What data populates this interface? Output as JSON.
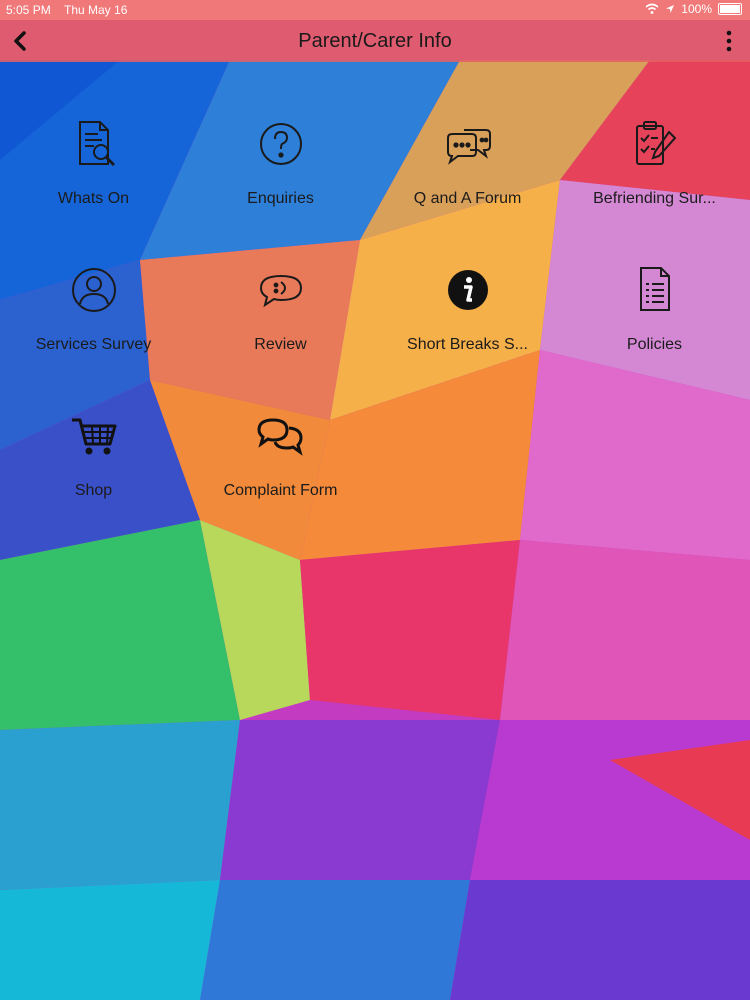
{
  "status_bar": {
    "time": "5:05 PM",
    "date": "Thu May 16",
    "battery": "100%"
  },
  "app_bar": {
    "title": "Parent/Carer Info",
    "back_icon": "chevron-left-icon",
    "menu_icon": "kebab-menu-icon"
  },
  "tiles": [
    {
      "label": "Whats On",
      "icon": "document-search-icon"
    },
    {
      "label": "Enquiries",
      "icon": "question-circle-icon"
    },
    {
      "label": "Q and A Forum",
      "icon": "chat-bubbles-icon"
    },
    {
      "label": "Befriending Sur...",
      "icon": "clipboard-pen-icon"
    },
    {
      "label": "Services Survey",
      "icon": "user-circle-icon"
    },
    {
      "label": "Review",
      "icon": "speech-smile-icon"
    },
    {
      "label": "Short Breaks S...",
      "icon": "info-circle-icon"
    },
    {
      "label": "Policies",
      "icon": "document-list-icon"
    },
    {
      "label": "Shop",
      "icon": "shopping-cart-icon"
    },
    {
      "label": "Complaint Form",
      "icon": "comment-bubbles-icon"
    }
  ],
  "colors": {
    "status_bar": "#f07878",
    "app_bar": "#e26064",
    "icon": "#1a1a1a"
  }
}
